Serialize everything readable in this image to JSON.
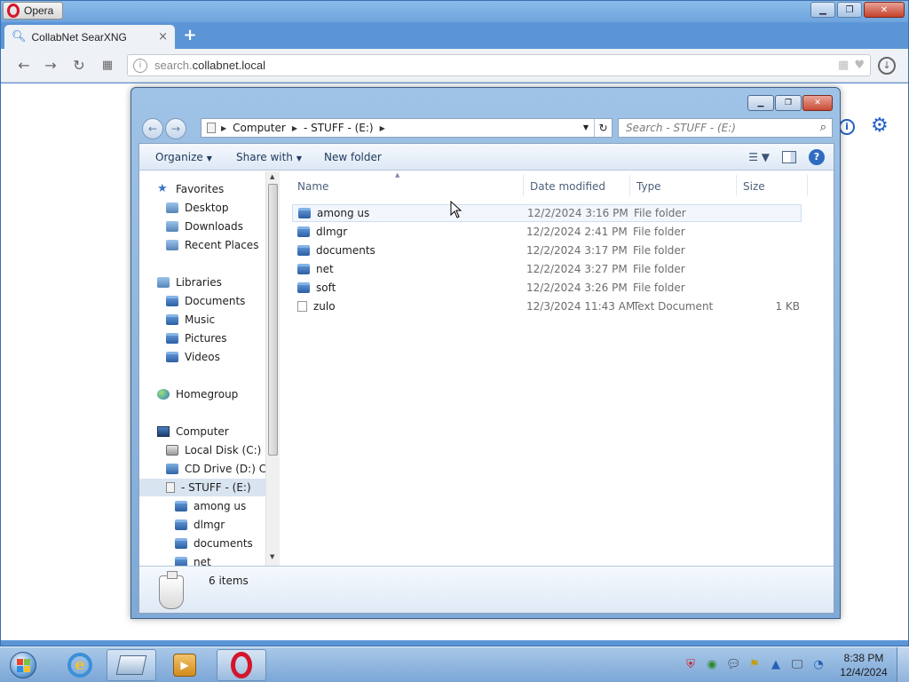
{
  "browser": {
    "app_name": "Opera",
    "tab_title": "CollabNet SearXNG",
    "tab_close": "×",
    "new_tab": "+",
    "url_prefix": "search.",
    "url_domain": "collabnet.local"
  },
  "explorer": {
    "breadcrumb": [
      "Computer",
      "- STUFF - (E:)"
    ],
    "search_placeholder": "Search - STUFF - (E:)",
    "commands": {
      "organize": "Organize",
      "share_with": "Share with",
      "new_folder": "New folder"
    },
    "nav": {
      "favorites": "Favorites",
      "desktop": "Desktop",
      "downloads": "Downloads",
      "recent_places": "Recent Places",
      "libraries": "Libraries",
      "documents": "Documents",
      "music": "Music",
      "pictures": "Pictures",
      "videos": "Videos",
      "homegroup": "Homegroup",
      "computer": "Computer",
      "local_disk": "Local Disk (C:)",
      "cd_drive": "CD Drive (D:) CD",
      "stuff_drive": "- STUFF - (E:)",
      "sub_among_us": "among us",
      "sub_dlmgr": "dlmgr",
      "sub_documents": "documents",
      "sub_net": "net"
    },
    "columns": {
      "name": "Name",
      "date": "Date modified",
      "type": "Type",
      "size": "Size"
    },
    "files": [
      {
        "name": "among us",
        "date": "12/2/2024 3:16 PM",
        "type": "File folder",
        "size": "",
        "icon": "folder-icon"
      },
      {
        "name": "dlmgr",
        "date": "12/2/2024 2:41 PM",
        "type": "File folder",
        "size": "",
        "icon": "folder-icon"
      },
      {
        "name": "documents",
        "date": "12/2/2024 3:17 PM",
        "type": "File folder",
        "size": "",
        "icon": "folder-icon"
      },
      {
        "name": "net",
        "date": "12/2/2024 3:27 PM",
        "type": "File folder",
        "size": "",
        "icon": "folder-icon"
      },
      {
        "name": "soft",
        "date": "12/2/2024 3:26 PM",
        "type": "File folder",
        "size": "",
        "icon": "folder-icon"
      },
      {
        "name": "zulo",
        "date": "12/3/2024 11:43 AM",
        "type": "Text Document",
        "size": "1 KB",
        "icon": "text-file-icon"
      }
    ],
    "status": "6 items"
  },
  "taskbar": {
    "time": "8:38 PM",
    "date": "12/4/2024"
  }
}
